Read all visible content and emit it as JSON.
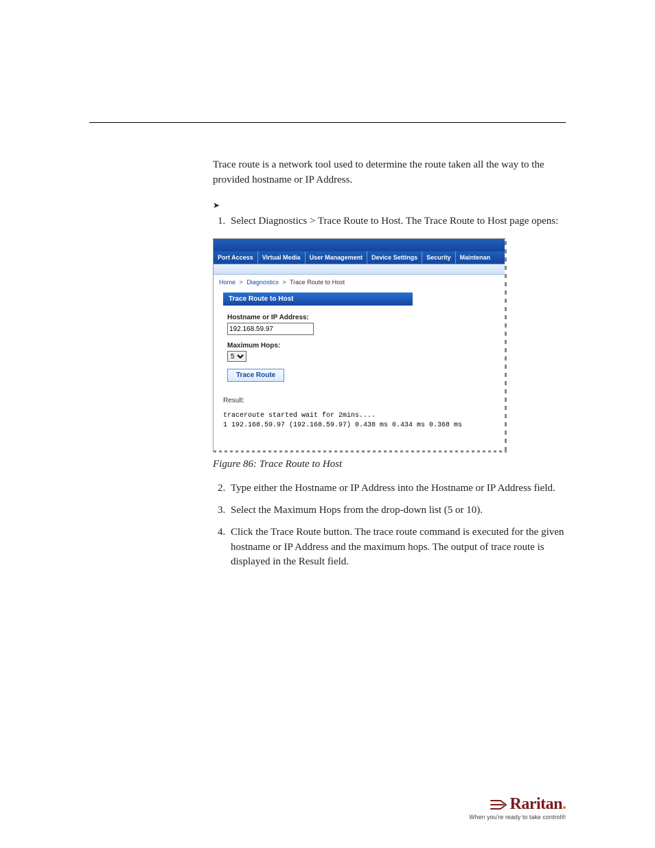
{
  "intro": "Trace route is a network tool used to determine the route taken all the way to the provided hostname or IP Address.",
  "steps_a": {
    "1": "Select Diagnostics > Trace Route to Host. The Trace Route to Host page opens:"
  },
  "figure_caption": "Figure 86: Trace Route to Host",
  "steps_b": {
    "2": "Type either the Hostname or IP Address into the Hostname or IP Address field.",
    "3": "Select the Maximum Hops from the drop-down list (5 or 10).",
    "4": "Click the Trace Route button. The trace route command is executed for the given hostname or IP Address and the maximum hops. The output of trace route is displayed in the Result field."
  },
  "app": {
    "tabs": [
      "Port Access",
      "Virtual Media",
      "User Management",
      "Device Settings",
      "Security",
      "Maintenan"
    ],
    "crumbs": {
      "home": "Home",
      "diag": "Diagnostics",
      "current": "Trace Route to Host"
    },
    "panel_title": "Trace Route to Host",
    "hostname_label": "Hostname or IP Address:",
    "hostname_value": "192.168.59.97",
    "maxhops_label": "Maximum Hops:",
    "maxhops_value": "5",
    "button_label": "Trace Route",
    "result_label": "Result:",
    "result_lines": "traceroute started wait for 2mins....\n1 192.168.59.97 (192.168.59.97) 0.438 ms 0.434 ms 0.368 ms"
  },
  "footer": {
    "brand": "Raritan",
    "tagline": "When you're ready to take control®"
  }
}
